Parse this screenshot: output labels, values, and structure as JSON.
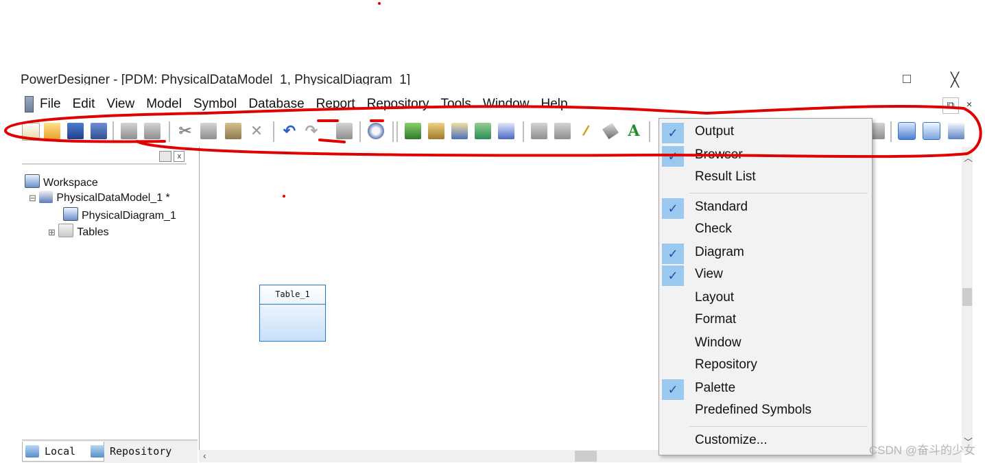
{
  "window": {
    "title": "PowerDesigner - [PDM: PhysicalDataModel_1, PhysicalDiagram_1]",
    "maximize_glyph": "□",
    "close_glyph": "╳",
    "mdi_restore_glyph": "⧉",
    "mdi_close_glyph": "×"
  },
  "menubar": {
    "items": [
      "File",
      "Edit",
      "View",
      "Model",
      "Symbol",
      "Database",
      "Report",
      "Repository",
      "Tools",
      "Window",
      "Help"
    ]
  },
  "toolbar": {
    "cut_glyph": "✂",
    "delete_glyph": "✕",
    "undo_glyph": "↶",
    "redo_glyph": "↷",
    "brush_glyph": "/",
    "text_glyph": "A"
  },
  "browser": {
    "tree": [
      {
        "label": "Workspace"
      },
      {
        "label": "PhysicalDataModel_1 *"
      },
      {
        "label": "PhysicalDiagram_1"
      },
      {
        "label": "Tables"
      }
    ],
    "tabs": {
      "local": "Local",
      "repository": "Repository"
    },
    "expand_glyph": "⊟",
    "collapse_glyph": "⊞"
  },
  "diagram": {
    "table_symbol_name": "Table_1"
  },
  "context_menu": {
    "check_glyph": "✓",
    "items": [
      {
        "label": "Output",
        "checked": true
      },
      {
        "label": "Browser",
        "checked": true
      },
      {
        "label": "Result List",
        "checked": false
      },
      {
        "label": "Standard",
        "checked": true
      },
      {
        "label": "Check",
        "checked": false
      },
      {
        "label": "Diagram",
        "checked": true
      },
      {
        "label": "View",
        "checked": true
      },
      {
        "label": "Layout",
        "checked": false
      },
      {
        "label": "Format",
        "checked": false
      },
      {
        "label": "Window",
        "checked": false
      },
      {
        "label": "Repository",
        "checked": false
      },
      {
        "label": "Palette",
        "checked": true
      },
      {
        "label": "Predefined Symbols",
        "checked": false
      },
      {
        "label": "Customize...",
        "checked": false
      }
    ]
  },
  "watermark": "CSDN @奋斗的少女",
  "colors": {
    "annotation": "#e00000",
    "menu_check_bg": "#9bc8ef",
    "table_border": "#2a74c9"
  }
}
